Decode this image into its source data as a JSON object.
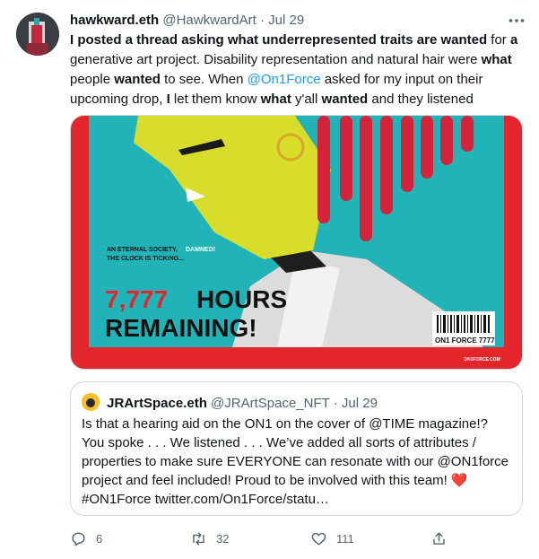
{
  "tweet": {
    "author_name": "hawkward.eth",
    "author_handle": "@HawkwardArt",
    "separator": "·",
    "date": "Jul 29",
    "text": {
      "p1": "I posted a thread asking what underrepresented traits are wanted",
      "p2": " for ",
      "p3": "a",
      "p4": " generative art project. Disability representation and natural hair were ",
      "p5": "what",
      "p6": " people ",
      "p7": "wanted",
      "p8": " to see. When ",
      "mention": "@On1Force",
      "p9": " asked for my input on their upcoming drop, ",
      "p10": "I",
      "p11": " let them know ",
      "p12": "what",
      "p13": " y'all ",
      "p14": "wanted",
      "p15": " and they listened"
    },
    "media": {
      "headline_small_1": "AN ETERNAL SOCIETY,",
      "headline_small_damned": "DAMNED!",
      "headline_small_2": "THE CLOCK IS TICKING...",
      "big_number": "7,777",
      "big_hours": "HOURS",
      "big_remaining": "REMAINING!",
      "barcode_label": "ON1 FORCE 7777",
      "footer_url": "ON1FORCE.COM"
    },
    "actions": {
      "replies": "6",
      "retweets": "32",
      "likes": "111"
    }
  },
  "quote": {
    "author_name": "JRArtSpace.eth",
    "author_handle": "@JRArtSpace_NFT",
    "separator": "·",
    "date": "Jul 29",
    "text": "Is that a hearing aid on the ON1 on the cover of @TIME magazine!? You spoke . . . We listened . . . We’ve added all sorts of attributes / properties to make sure EVERYONE can resonate with our @ON1force project and feel included! Proud to be involved with this team!",
    "heart": "❤️",
    "text_tail": "#ON1Force twitter.com/On1Force/statu…"
  },
  "colors": {
    "accent": "#1d9bf0",
    "muted": "#536471",
    "magazine_red": "#e3262c",
    "magazine_teal": "#22b3b8"
  }
}
